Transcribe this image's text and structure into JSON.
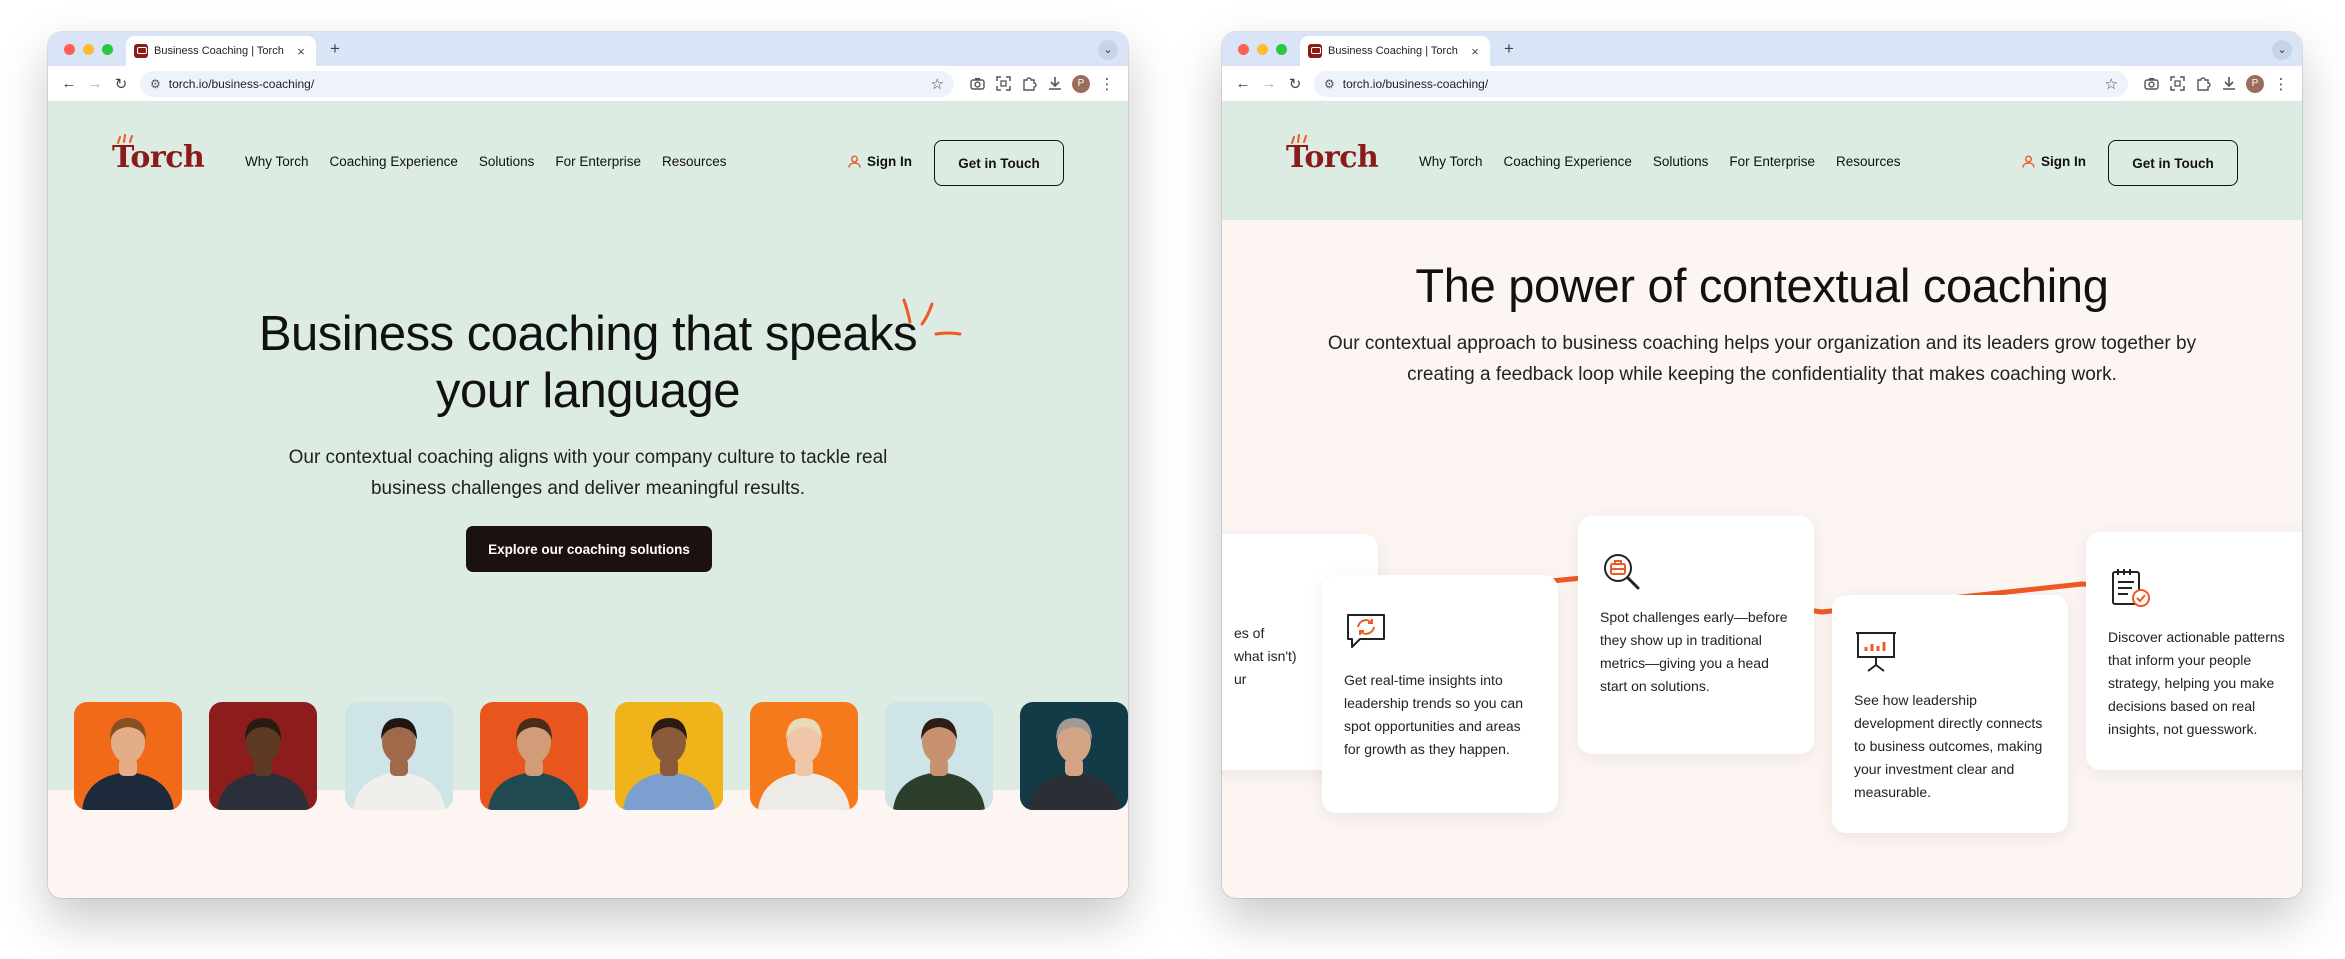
{
  "browser": {
    "tab_title": "Business Coaching | Torch",
    "tab_close": "×",
    "new_tab": "+",
    "tab_menu": "⌄",
    "url": "torch.io/business-coaching/",
    "profile_initial": "P"
  },
  "nav": {
    "logo": "Torch",
    "links": [
      "Why Torch",
      "Coaching Experience",
      "Solutions",
      "For Enterprise",
      "Resources"
    ],
    "sign_in": "Sign In",
    "cta": "Get in Touch"
  },
  "hero": {
    "title_line1": "Business coaching that speaks",
    "title_line2": "your language",
    "subtitle_line1": "Our contextual coaching aligns with your company culture to tackle real",
    "subtitle_line2": "business challenges and deliver meaningful results.",
    "cta": "Explore our coaching solutions"
  },
  "photos": [
    {
      "bg": "#f06a1a",
      "skin": "#e2ae86",
      "hair": "#8a4e23",
      "shirt": "#1e2a3b"
    },
    {
      "bg": "#8d1c1c",
      "skin": "#5e3a24",
      "hair": "#2a1a12",
      "shirt": "#2b2f3a"
    },
    {
      "bg": "#cfe4e6",
      "skin": "#a0694a",
      "hair": "#1f1612",
      "shirt": "#f1efeb"
    },
    {
      "bg": "#e8561d",
      "skin": "#d29c78",
      "hair": "#4a2c1c",
      "shirt": "#1f4a4f"
    },
    {
      "bg": "#f0b31a",
      "skin": "#8b5a3c",
      "hair": "#2b1b14",
      "shirt": "#7d9fd0"
    },
    {
      "bg": "#f57a1c",
      "skin": "#efc6a8",
      "hair": "#ead9b5",
      "shirt": "#ecebe6"
    },
    {
      "bg": "#cfe4e6",
      "skin": "#c89270",
      "hair": "#2c1d16",
      "shirt": "#2c3e2c"
    },
    {
      "bg": "#123b47",
      "skin": "#d3a486",
      "hair": "#9e9a95",
      "shirt": "#2a2f36"
    }
  ],
  "section": {
    "title": "The power of contextual coaching",
    "subtitle_line1": "Our contextual approach to business coaching helps your organization and its leaders grow together by",
    "subtitle_line2": "creating a feedback loop while keeping the confidentiality that makes coaching work.",
    "cards": [
      {
        "icon": "partial-card",
        "lines": [
          "es of",
          "what isn't)",
          "ur"
        ]
      },
      {
        "icon": "chat-refresh-icon",
        "lines": [
          "Get real-time insights into",
          "leadership trends so you can",
          "spot opportunities and areas",
          "for growth as they happen."
        ]
      },
      {
        "icon": "magnify-briefcase-icon",
        "lines": [
          "Spot challenges early—before",
          "they show up in traditional",
          "metrics—giving you a head",
          "start on solutions."
        ]
      },
      {
        "icon": "presentation-chart-icon",
        "lines": [
          "See how leadership",
          "development directly connects",
          "to business outcomes, making",
          "your investment clear and",
          "measurable."
        ]
      },
      {
        "icon": "clipboard-check-icon",
        "lines": [
          "Discover actionable patterns",
          "that inform your people",
          "strategy, helping you make",
          "decisions based on real",
          "insights, not guesswork."
        ]
      }
    ]
  },
  "colors": {
    "brand": "#8b1a1a",
    "accent": "#ee5a24",
    "hero_bg": "#ddece2",
    "section_bg": "#fdf5f2",
    "button_dark": "#1b1210"
  }
}
